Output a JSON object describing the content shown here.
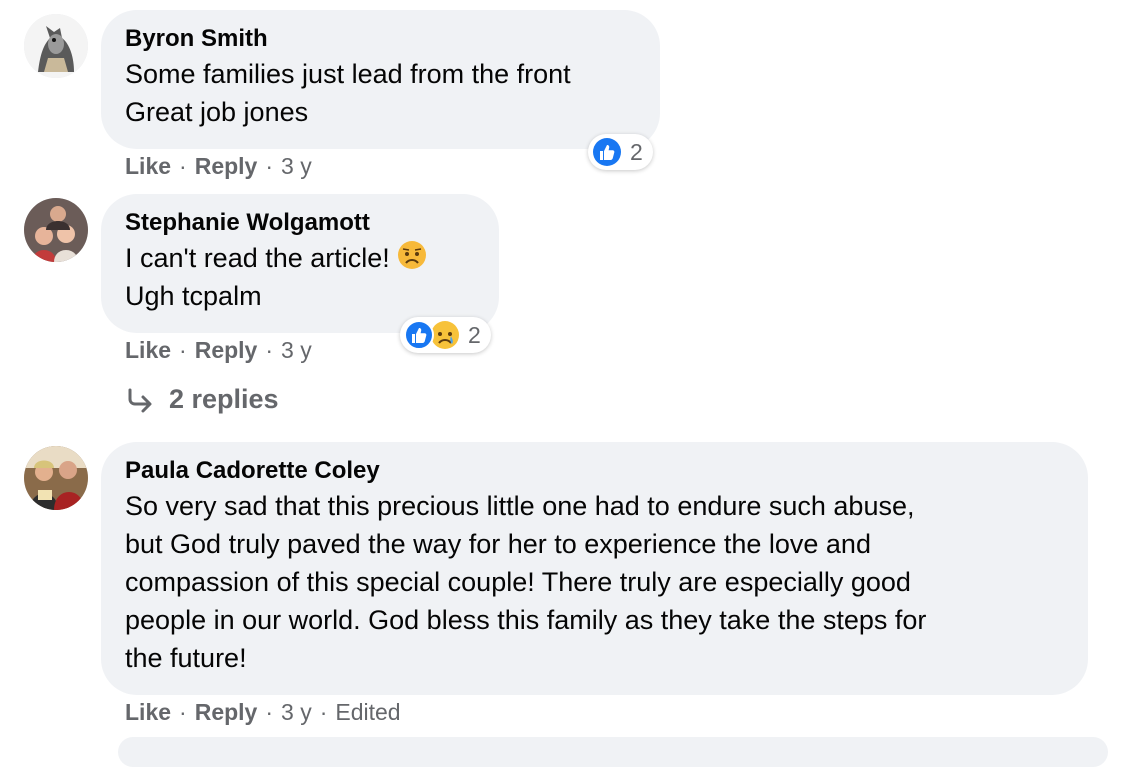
{
  "comments": [
    {
      "author": "Byron Smith",
      "lines": [
        "Some families just lead from the front",
        "Great job jones"
      ],
      "actions": {
        "like": "Like",
        "reply": "Reply",
        "time": "3 y"
      },
      "reactions": {
        "icons": [
          "like-icon"
        ],
        "count": "2"
      }
    },
    {
      "author": "Stephanie Wolgamott",
      "lines": [
        "I can't read the article!",
        "Ugh tcpalm"
      ],
      "emoji": "sad-face-emoji",
      "actions": {
        "like": "Like",
        "reply": "Reply",
        "time": "3 y"
      },
      "reactions": {
        "icons": [
          "like-icon",
          "sad-icon"
        ],
        "count": "2"
      },
      "replies_label": "2 replies"
    },
    {
      "author": "Paula Cadorette Coley",
      "lines": [
        "So very sad that this precious little one had to endure such abuse,",
        "but God truly paved the way for her to experience the love and",
        "compassion of this special couple! There truly are especially good",
        "people in our world. God bless this family as they take the steps for",
        "the future!"
      ],
      "actions": {
        "like": "Like",
        "reply": "Reply",
        "time": "3 y",
        "edited": "Edited"
      }
    }
  ],
  "colors": {
    "like_blue": "#1877f2",
    "bubble_bg": "#f0f2f5",
    "meta_gray": "#65676b"
  }
}
